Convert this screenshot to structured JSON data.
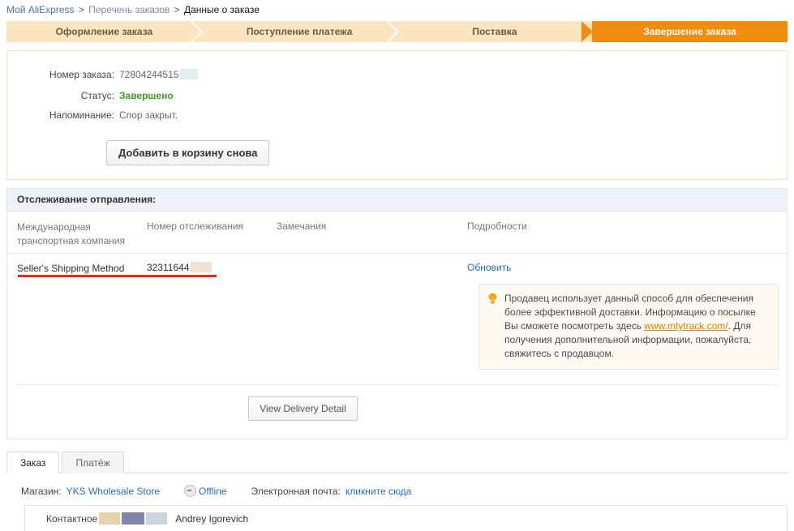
{
  "breadcrumb": {
    "home": "Мой AliExpress",
    "sep1": ">",
    "orders": "Перечень заказов",
    "sep2": ">",
    "current": "Данные о заказе"
  },
  "steps": [
    {
      "label": "Оформление заказа",
      "active": false
    },
    {
      "label": "Поступление платежа",
      "active": false
    },
    {
      "label": "Поставка",
      "active": false
    },
    {
      "label": "Завершение заказа",
      "active": true
    }
  ],
  "order": {
    "number_label": "Номер заказа:",
    "number_value": "72804244515",
    "status_label": "Статус:",
    "status_value": "Завершено",
    "reminder_label": "Напоминание:",
    "reminder_value": "Спор закрыт.",
    "add_to_cart_label": "Добавить в корзину снова"
  },
  "tracking": {
    "panel_title": "Отслеживание отправления:",
    "columns": {
      "carrier": "Международная транспортная компания",
      "number": "Номер отслеживания",
      "notes": "Замечания",
      "details": "Подробности"
    },
    "row": {
      "carrier": "Seller's Shipping Method",
      "number": "32311644",
      "notes": "",
      "details_link": "Обновить"
    },
    "tip": {
      "text_before": "Продавец использует данный способ для обеспечения более эффективной доставки. Информацию о посылке Вы сможете посмотреть здесь ",
      "link": "www.mtytrack.com/",
      "text_after": ". Для получения дополнительной информации, пожалуйста, свяжитесь с продавцом."
    },
    "delivery_button": "View Delivery Detail"
  },
  "tabs": [
    {
      "label": "Заказ",
      "active": true
    },
    {
      "label": "Платёж",
      "active": false
    }
  ],
  "store": {
    "label": "Магазин:",
    "name": "YKS Wholesale Store",
    "status": "Offline",
    "email_label": "Электронная почта:",
    "email_link": "кликните сюда"
  },
  "contact": {
    "label": "Контактное",
    "name": "Andrey Igorevich"
  },
  "colors": {
    "accent_orange": "#f28c0f",
    "step_inactive": "#fbe4c0",
    "status_green": "#3f9b24",
    "link_blue": "#2b6bb5",
    "red_underline": "#e82b10",
    "tip_link_orange": "#e28000"
  }
}
